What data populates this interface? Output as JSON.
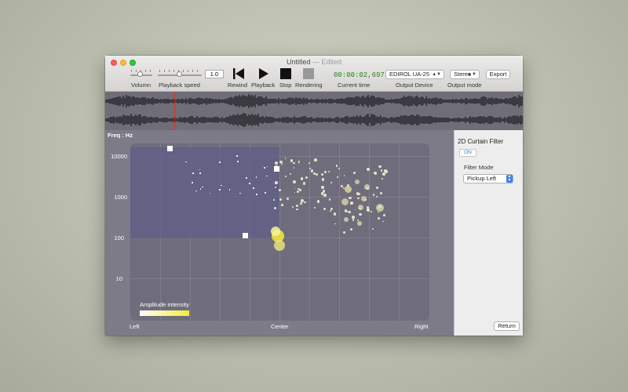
{
  "window": {
    "title": "Untitled",
    "edited": "— Edited"
  },
  "toolbar": {
    "volume_label": "Volumn",
    "volume_level": 0.35,
    "playback_speed_label": "Playback speed",
    "playback_speed_value": "1.0",
    "rewind_label": "Rewind",
    "playback_label": "Playback",
    "stop_label": "Stop",
    "rendering_label": "Rendering",
    "current_time_value": "00:00:02,697",
    "current_time_label": "Current time",
    "output_device_value": "EDIROL UA-25",
    "output_device_label": "Output Device",
    "output_mode_value": "Stereo",
    "output_mode_label": "Output mode",
    "export_label": "Export"
  },
  "plot": {
    "freq_label": "Freq : Hz",
    "y_ticks": [
      "10000",
      "1000",
      "100",
      "10"
    ],
    "x_ticks": [
      "Left",
      "Center",
      "Right"
    ],
    "amplitude_label": "Amplitude intensity"
  },
  "sidebar": {
    "title": "2D Curtain Filter",
    "on_label": "ON",
    "filter_mode_label": "Filter Mode",
    "filter_mode_value": "Pickup Left",
    "return_label": "Return"
  },
  "colors": {
    "playhead": "#d0342c",
    "time_text": "#2a7a1c",
    "accent_blue": "#3c84e4",
    "dot_yellow": "#f4ec3a"
  }
}
